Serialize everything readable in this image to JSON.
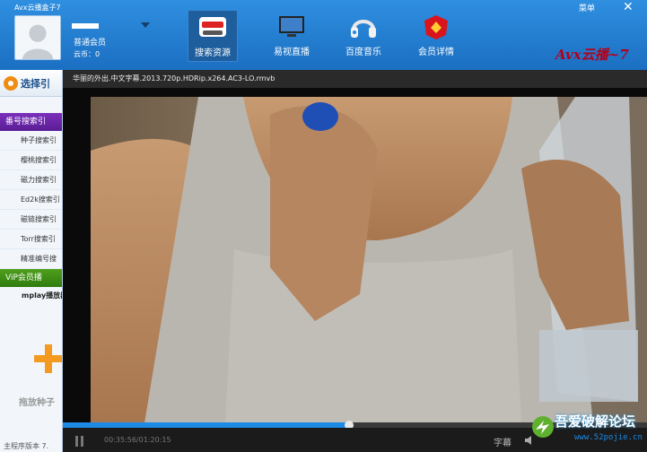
{
  "app": {
    "title": "Avx云播盒子7",
    "brand": "Avx云播~7"
  },
  "user": {
    "level": "普通会员",
    "coins": "云币：0"
  },
  "nav": [
    {
      "label": "搜索资源",
      "icon": "search-resources-icon",
      "active": true
    },
    {
      "label": "易视直播",
      "icon": "tv-icon",
      "active": false
    },
    {
      "label": "百度音乐",
      "icon": "headphones-icon",
      "active": false
    },
    {
      "label": "会员详情",
      "icon": "vip-badge-icon",
      "active": false
    }
  ],
  "window": {
    "menu": "菜单",
    "close": "✕"
  },
  "sidebar": {
    "select_title": "选择引",
    "search_section": "番号搜索引",
    "items": [
      "种子搜索引",
      "樱桃搜索引",
      "磁力搜索引",
      "Ed2k搜索引",
      "磁链搜索引",
      "Torr搜索引",
      "精准编号搜"
    ],
    "vip_section": "ViP会员播",
    "mplay": "mplay播放器",
    "drag_label": "拖放种子",
    "version": "主程序版本 7."
  },
  "player": {
    "file_name": "华丽的外出.中文字幕.2013.720p.HDRip.x264.AC3-LO.rmvb",
    "time": "00:35:56/01:20:15",
    "progress": 0.49,
    "subtitle": "字幕"
  },
  "watermark": {
    "title": "吾爱破解论坛",
    "url": "www.52pojie.cn"
  },
  "colors": {
    "topbar": "#1b6fc2",
    "accent": "#1d8ae6",
    "purple_section": "#6a26a8",
    "green_section": "#3d8c14",
    "brand": "#b3001a"
  }
}
